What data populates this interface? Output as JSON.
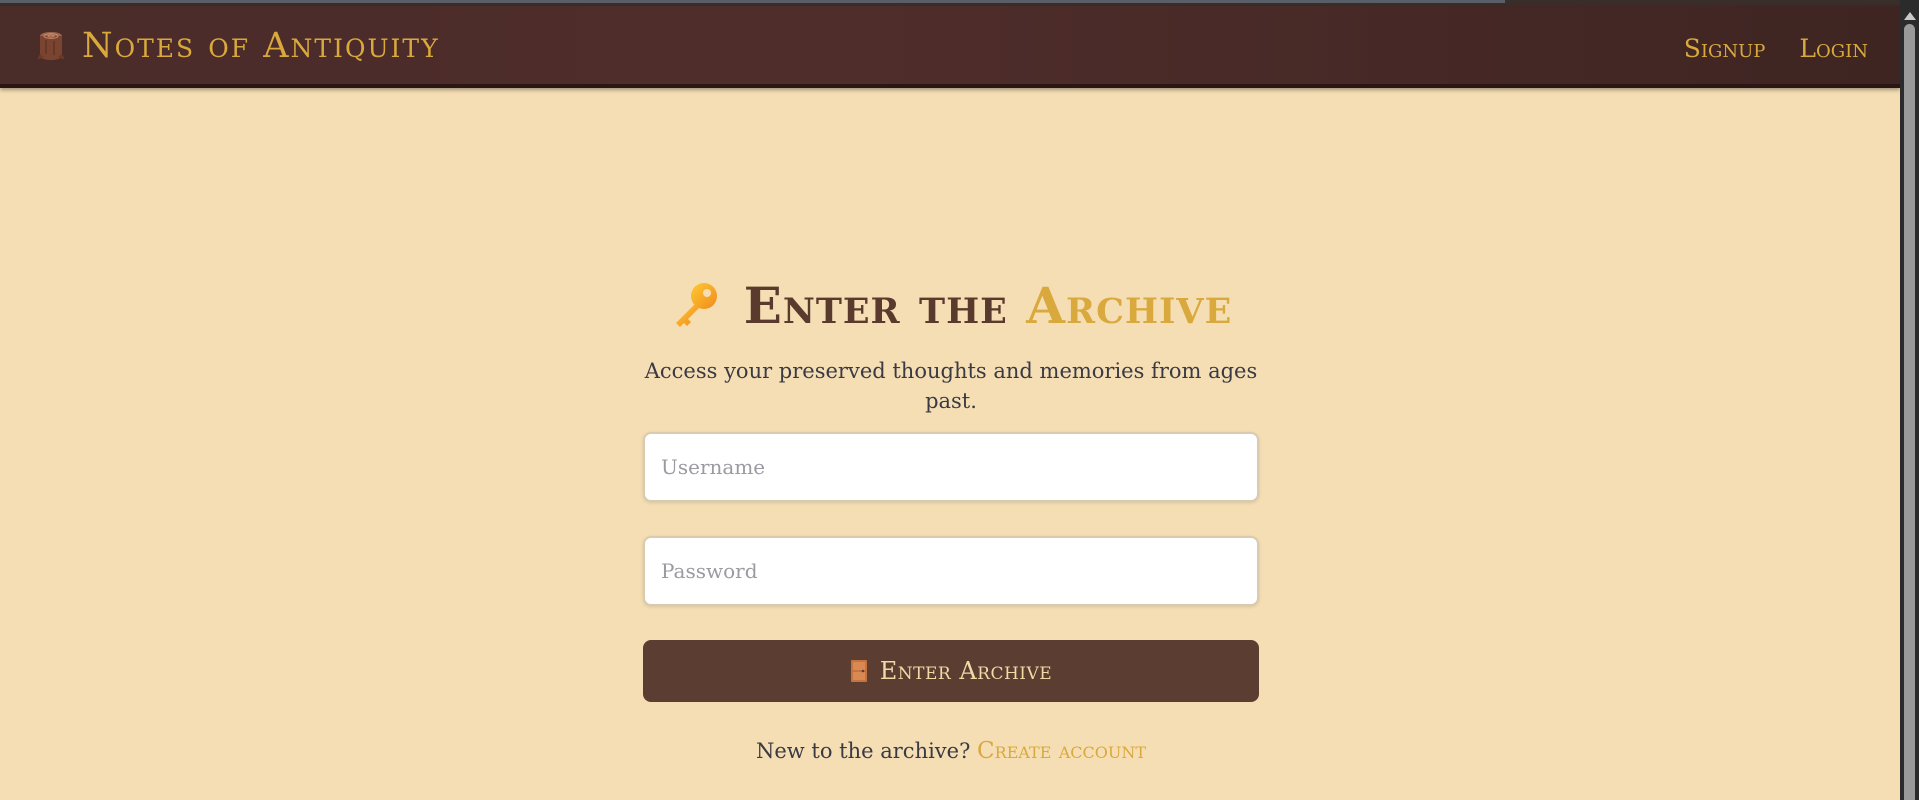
{
  "navbar": {
    "brand_icon": "tree-stump-icon",
    "brand_title": "Notes of Antiquity",
    "links": [
      {
        "label": "Signup"
      },
      {
        "label": "Login"
      }
    ]
  },
  "login": {
    "heading_icon": "key-icon",
    "heading_main": "Enter the ",
    "heading_accent": "Archive",
    "subtitle": "Access your preserved thoughts and memories from ages past.",
    "username_placeholder": "Username",
    "password_placeholder": "Password",
    "submit_icon": "door-icon",
    "submit_label": "Enter Archive",
    "signup_prompt": "New to the archive? ",
    "signup_link": "Create account"
  },
  "colors": {
    "page_background": "#f5deb3",
    "navbar_background": "#4a2c29",
    "gold_accent": "#d9a93d",
    "heading_brown": "#5b3a2e",
    "button_background": "#5c3d32"
  }
}
